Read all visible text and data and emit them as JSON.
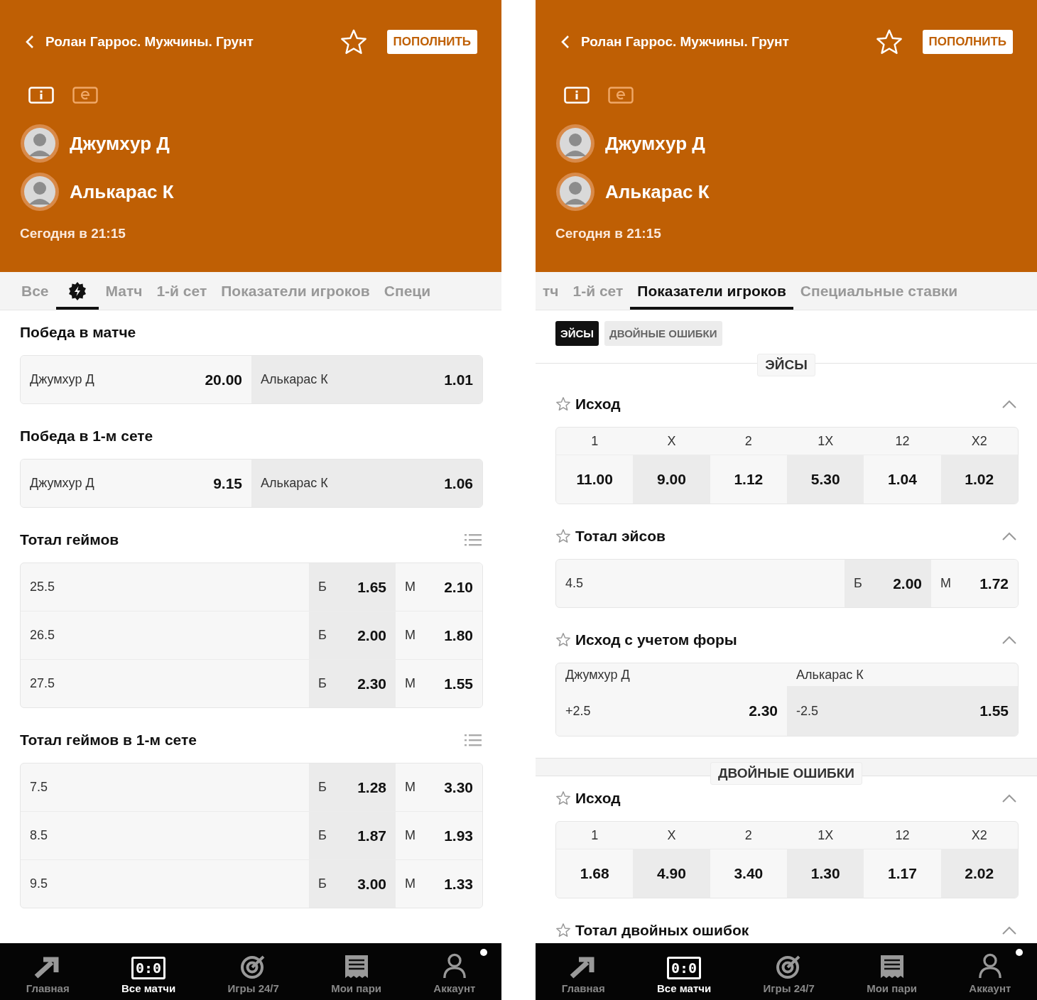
{
  "screens": [
    {
      "header": {
        "title": "Ролан Гаррос. Мужчины. Грунт",
        "deposit": "ПОПОЛНИТЬ",
        "players": [
          "Джумхур Д",
          "Алькарас К"
        ],
        "time": "Сегодня в 21:15"
      },
      "tabs": [
        {
          "kind": "text",
          "label": "Все",
          "selected": false
        },
        {
          "kind": "icon",
          "selected": true
        },
        {
          "kind": "text",
          "label": "Матч",
          "selected": false
        },
        {
          "kind": "text",
          "label": "1-й сет",
          "selected": false
        },
        {
          "kind": "text",
          "label": "Показатели игроков",
          "selected": false
        },
        {
          "kind": "text",
          "label": "Специ",
          "selected": false
        }
      ],
      "sections": [
        {
          "kind": "two-way",
          "title": "Победа в матче",
          "options": [
            {
              "label": "Джумхур Д",
              "odd": "20.00"
            },
            {
              "label": "Алькарас К",
              "odd": "1.01"
            }
          ]
        },
        {
          "kind": "two-way",
          "title": "Победа в 1-м сете",
          "options": [
            {
              "label": "Джумхур Д",
              "odd": "9.15"
            },
            {
              "label": "Алькарас К",
              "odd": "1.06"
            }
          ]
        },
        {
          "kind": "totals",
          "title": "Тотал геймов",
          "list_button": true,
          "rows": [
            {
              "line": "25.5",
              "over_label": "Б",
              "over": "1.65",
              "under_label": "М",
              "under": "2.10"
            },
            {
              "line": "26.5",
              "over_label": "Б",
              "over": "2.00",
              "under_label": "М",
              "under": "1.80"
            },
            {
              "line": "27.5",
              "over_label": "Б",
              "over": "2.30",
              "under_label": "М",
              "under": "1.55"
            }
          ]
        },
        {
          "kind": "totals",
          "title": "Тотал геймов в 1-м сете",
          "list_button": true,
          "rows": [
            {
              "line": "7.5",
              "over_label": "Б",
              "over": "1.28",
              "under_label": "М",
              "under": "3.30"
            },
            {
              "line": "8.5",
              "over_label": "Б",
              "over": "1.87",
              "under_label": "М",
              "under": "1.93"
            },
            {
              "line": "9.5",
              "over_label": "Б",
              "over": "3.00",
              "under_label": "М",
              "under": "1.33"
            }
          ]
        }
      ],
      "nav": [
        {
          "kind": "arrow",
          "label": "Главная",
          "selected": false
        },
        {
          "kind": "score",
          "label": "Все матчи",
          "icon_text": "0:0",
          "selected": true
        },
        {
          "kind": "target",
          "label": "Игры 24/7",
          "selected": false
        },
        {
          "kind": "receipt",
          "label": "Мои пари",
          "selected": false
        },
        {
          "kind": "person",
          "label": "Аккаунт",
          "selected": false,
          "dot": true
        }
      ]
    },
    {
      "header": {
        "title": "Ролан Гаррос. Мужчины. Грунт",
        "deposit": "ПОПОЛНИТЬ",
        "players": [
          "Джумхур Д",
          "Алькарас К"
        ],
        "time": "Сегодня в 21:15"
      },
      "tabs": [
        {
          "kind": "text",
          "label": "тч",
          "selected": false
        },
        {
          "kind": "text",
          "label": "1-й сет",
          "selected": false
        },
        {
          "kind": "text",
          "label": "Показатели игроков",
          "selected": true
        },
        {
          "kind": "text",
          "label": "Специальные ставки",
          "selected": false
        }
      ],
      "chips": [
        {
          "label": "ЭЙСЫ",
          "selected": true
        },
        {
          "label": "ДВОЙНЫЕ ОШИБКИ",
          "selected": false
        }
      ],
      "sections": [
        {
          "kind": "divider",
          "label": "ЭЙСЫ"
        },
        {
          "kind": "outcome",
          "title": "Исход",
          "favorite_button": true,
          "expanded": true,
          "headers": [
            "1",
            "X",
            "2",
            "1X",
            "12",
            "X2"
          ],
          "odds": [
            "11.00",
            "9.00",
            "1.12",
            "5.30",
            "1.04",
            "1.02"
          ]
        },
        {
          "kind": "totals",
          "title": "Тотал эйсов",
          "favorite_button": true,
          "expanded": true,
          "rows": [
            {
              "line": "4.5",
              "over_label": "Б",
              "over": "2.00",
              "under_label": "М",
              "under": "1.72"
            }
          ]
        },
        {
          "kind": "handicap",
          "title": "Исход с учетом форы",
          "favorite_button": true,
          "expanded": true,
          "options": [
            {
              "name": "Джумхур Д",
              "line": "+2.5",
              "odd": "2.30"
            },
            {
              "name": "Алькарас К",
              "line": "-2.5",
              "odd": "1.55"
            }
          ]
        },
        {
          "kind": "divider",
          "label": "ДВОЙНЫЕ ОШИБКИ",
          "band": true
        },
        {
          "kind": "outcome",
          "title": "Исход",
          "favorite_button": true,
          "expanded": true,
          "headers": [
            "1",
            "X",
            "2",
            "1X",
            "12",
            "X2"
          ],
          "odds": [
            "1.68",
            "4.90",
            "3.40",
            "1.30",
            "1.17",
            "2.02"
          ]
        },
        {
          "kind": "heading",
          "title": "Тотал двойных ошибок",
          "favorite_button": true,
          "expanded": true
        }
      ],
      "nav": [
        {
          "kind": "arrow",
          "label": "Главная",
          "selected": false
        },
        {
          "kind": "score",
          "label": "Все матчи",
          "icon_text": "0:0",
          "selected": true
        },
        {
          "kind": "target",
          "label": "Игры 24/7",
          "selected": false
        },
        {
          "kind": "receipt",
          "label": "Мои пари",
          "selected": false
        },
        {
          "kind": "person",
          "label": "Аккаунт",
          "selected": false,
          "dot": true
        }
      ]
    }
  ]
}
